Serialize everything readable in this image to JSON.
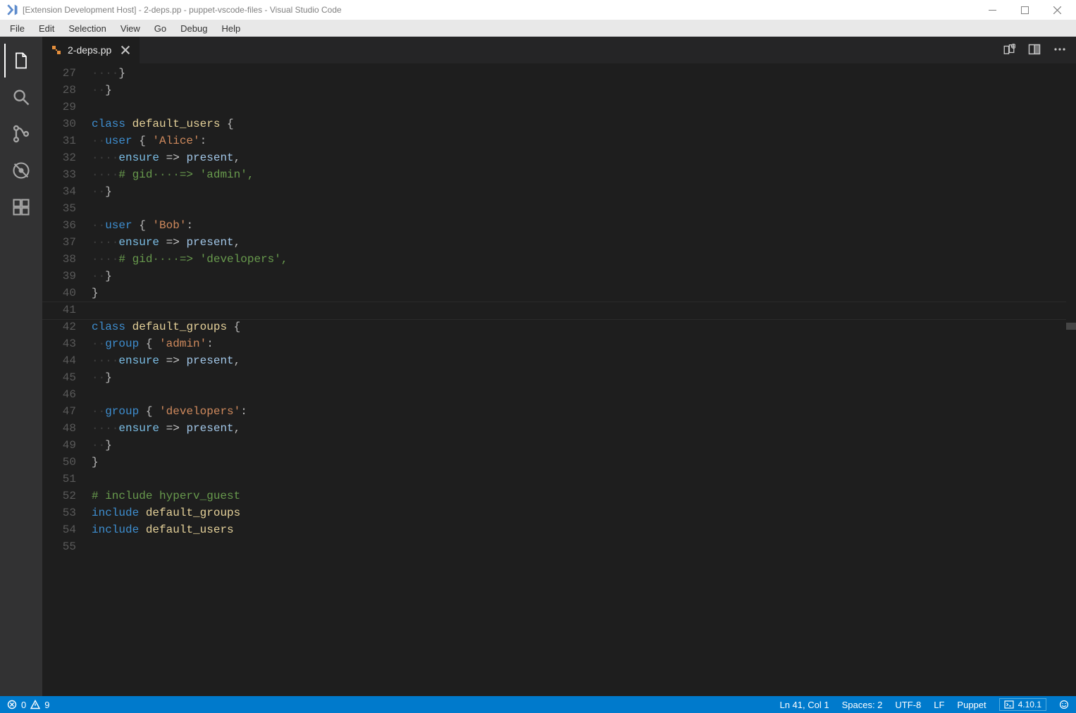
{
  "titlebar": {
    "text": "[Extension Development Host] - 2-deps.pp - puppet-vscode-files - Visual Studio Code"
  },
  "menubar": {
    "items": [
      "File",
      "Edit",
      "Selection",
      "View",
      "Go",
      "Debug",
      "Help"
    ]
  },
  "activitybar": {
    "items": [
      {
        "name": "explorer-icon",
        "active": true
      },
      {
        "name": "search-icon",
        "active": false
      },
      {
        "name": "scm-icon",
        "active": false
      },
      {
        "name": "debug-icon",
        "active": false
      },
      {
        "name": "extensions-icon",
        "active": false
      }
    ]
  },
  "tabs": {
    "active": {
      "label": "2-deps.pp"
    }
  },
  "editor": {
    "first_line_number": 27,
    "cursor_line_number": 41,
    "lines": [
      [
        {
          "cls": "ws",
          "t": "····"
        },
        {
          "cls": "dot",
          "t": "}"
        }
      ],
      [
        {
          "cls": "ws",
          "t": "··"
        },
        {
          "cls": "dot",
          "t": "}"
        }
      ],
      [],
      [
        {
          "cls": "kw",
          "t": "class"
        },
        {
          "cls": "dot",
          "t": " "
        },
        {
          "cls": "fn",
          "t": "default_users"
        },
        {
          "cls": "dot",
          "t": " {"
        }
      ],
      [
        {
          "cls": "ws",
          "t": "··"
        },
        {
          "cls": "kw",
          "t": "user"
        },
        {
          "cls": "dot",
          "t": " { "
        },
        {
          "cls": "str",
          "t": "'Alice'"
        },
        {
          "cls": "dot",
          "t": ":"
        }
      ],
      [
        {
          "cls": "ws",
          "t": "····"
        },
        {
          "cls": "id",
          "t": "ensure"
        },
        {
          "cls": "dot",
          "t": " "
        },
        {
          "cls": "arrow",
          "t": "=>"
        },
        {
          "cls": "dot",
          "t": " "
        },
        {
          "cls": "val",
          "t": "present"
        },
        {
          "cls": "dot",
          "t": ","
        }
      ],
      [
        {
          "cls": "ws",
          "t": "····"
        },
        {
          "cls": "cm",
          "t": "# gid"
        },
        {
          "cls": "cmws",
          "t": "····"
        },
        {
          "cls": "cm",
          "t": "=> 'admin',"
        }
      ],
      [
        {
          "cls": "ws",
          "t": "··"
        },
        {
          "cls": "dot",
          "t": "}"
        }
      ],
      [],
      [
        {
          "cls": "ws",
          "t": "··"
        },
        {
          "cls": "kw",
          "t": "user"
        },
        {
          "cls": "dot",
          "t": " { "
        },
        {
          "cls": "str",
          "t": "'Bob'"
        },
        {
          "cls": "dot",
          "t": ":"
        }
      ],
      [
        {
          "cls": "ws",
          "t": "····"
        },
        {
          "cls": "id",
          "t": "ensure"
        },
        {
          "cls": "dot",
          "t": " "
        },
        {
          "cls": "arrow",
          "t": "=>"
        },
        {
          "cls": "dot",
          "t": " "
        },
        {
          "cls": "val",
          "t": "present"
        },
        {
          "cls": "dot",
          "t": ","
        }
      ],
      [
        {
          "cls": "ws",
          "t": "····"
        },
        {
          "cls": "cm",
          "t": "# gid"
        },
        {
          "cls": "cmws",
          "t": "····"
        },
        {
          "cls": "cm",
          "t": "=> 'developers',"
        }
      ],
      [
        {
          "cls": "ws",
          "t": "··"
        },
        {
          "cls": "dot",
          "t": "}"
        }
      ],
      [
        {
          "cls": "dot",
          "t": "}"
        }
      ],
      [],
      [
        {
          "cls": "kw",
          "t": "class"
        },
        {
          "cls": "dot",
          "t": " "
        },
        {
          "cls": "fn",
          "t": "default_groups"
        },
        {
          "cls": "dot",
          "t": " {"
        }
      ],
      [
        {
          "cls": "ws",
          "t": "··"
        },
        {
          "cls": "kw",
          "t": "group"
        },
        {
          "cls": "dot",
          "t": " { "
        },
        {
          "cls": "str",
          "t": "'admin'"
        },
        {
          "cls": "dot",
          "t": ":"
        }
      ],
      [
        {
          "cls": "ws",
          "t": "····"
        },
        {
          "cls": "id",
          "t": "ensure"
        },
        {
          "cls": "dot",
          "t": " "
        },
        {
          "cls": "arrow",
          "t": "=>"
        },
        {
          "cls": "dot",
          "t": " "
        },
        {
          "cls": "val",
          "t": "present"
        },
        {
          "cls": "dot",
          "t": ","
        }
      ],
      [
        {
          "cls": "ws",
          "t": "··"
        },
        {
          "cls": "dot",
          "t": "}"
        }
      ],
      [],
      [
        {
          "cls": "ws",
          "t": "··"
        },
        {
          "cls": "kw",
          "t": "group"
        },
        {
          "cls": "dot",
          "t": " { "
        },
        {
          "cls": "str",
          "t": "'developers'"
        },
        {
          "cls": "dot",
          "t": ":"
        }
      ],
      [
        {
          "cls": "ws",
          "t": "····"
        },
        {
          "cls": "id",
          "t": "ensure"
        },
        {
          "cls": "dot",
          "t": " "
        },
        {
          "cls": "arrow",
          "t": "=>"
        },
        {
          "cls": "dot",
          "t": " "
        },
        {
          "cls": "val",
          "t": "present"
        },
        {
          "cls": "dot",
          "t": ","
        }
      ],
      [
        {
          "cls": "ws",
          "t": "··"
        },
        {
          "cls": "dot",
          "t": "}"
        }
      ],
      [
        {
          "cls": "dot",
          "t": "}"
        }
      ],
      [],
      [
        {
          "cls": "cm",
          "t": "# include hyperv_guest"
        }
      ],
      [
        {
          "cls": "kw",
          "t": "include"
        },
        {
          "cls": "dot",
          "t": " "
        },
        {
          "cls": "fn",
          "t": "default_groups"
        }
      ],
      [
        {
          "cls": "kw",
          "t": "include"
        },
        {
          "cls": "dot",
          "t": " "
        },
        {
          "cls": "fn",
          "t": "default_users"
        }
      ],
      []
    ]
  },
  "statusbar": {
    "errors": "0",
    "warnings": "9",
    "cursor": "Ln 41, Col 1",
    "indent": "Spaces: 2",
    "encoding": "UTF-8",
    "eol": "LF",
    "language": "Puppet",
    "feedback": "4.10.1"
  }
}
